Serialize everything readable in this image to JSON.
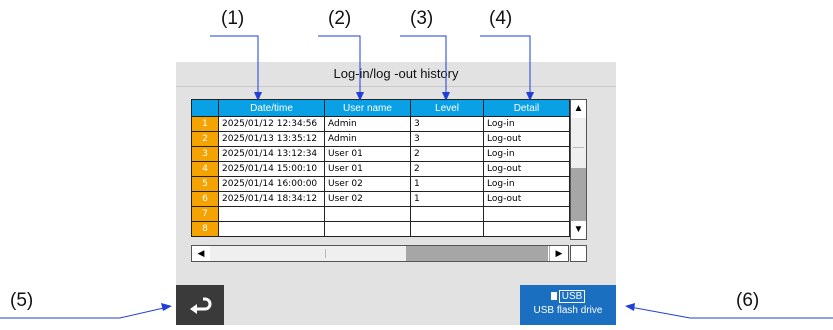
{
  "callouts": [
    "(1)",
    "(2)",
    "(3)",
    "(4)",
    "(5)",
    "(6)"
  ],
  "panel": {
    "title": "Log-in/log -out history"
  },
  "table": {
    "headers": [
      "Date/time",
      "User name",
      "Level",
      "Detail"
    ],
    "rows": [
      {
        "num": "1",
        "datetime": "2025/01/12   12:34:56",
        "user": "Admin",
        "level": "3",
        "detail": "Log-in"
      },
      {
        "num": "2",
        "datetime": "2025/01/13   13:35:12",
        "user": "Admin",
        "level": "3",
        "detail": "Log-out"
      },
      {
        "num": "3",
        "datetime": "2025/01/14   13:12:34",
        "user": "User 01",
        "level": "2",
        "detail": "Log-in"
      },
      {
        "num": "4",
        "datetime": "2025/01/14   15:00:10",
        "user": "User 01",
        "level": "2",
        "detail": "Log-out"
      },
      {
        "num": "5",
        "datetime": "2025/01/14   16:00:00",
        "user": "User 02",
        "level": "1",
        "detail": "Log-in"
      },
      {
        "num": "6",
        "datetime": "2025/01/14   18:34:12",
        "user": "User 02",
        "level": "1",
        "detail": "Log-out"
      },
      {
        "num": "7",
        "datetime": "",
        "user": "",
        "level": "",
        "detail": ""
      },
      {
        "num": "8",
        "datetime": "",
        "user": "",
        "level": "",
        "detail": ""
      }
    ]
  },
  "scroll": {
    "up": "▲",
    "down": "▼",
    "left": "◀",
    "right": "▶"
  },
  "buttons": {
    "back_icon": "return-arrow-icon",
    "usb_icon_text": "USB",
    "usb_label": "USB flash drive"
  },
  "colors": {
    "header": "#0aa0e6",
    "rownum": "#f5a300",
    "usb_button": "#1a6fc0",
    "back_button": "#3a3a3a",
    "arrows": "#1f3fd6"
  }
}
